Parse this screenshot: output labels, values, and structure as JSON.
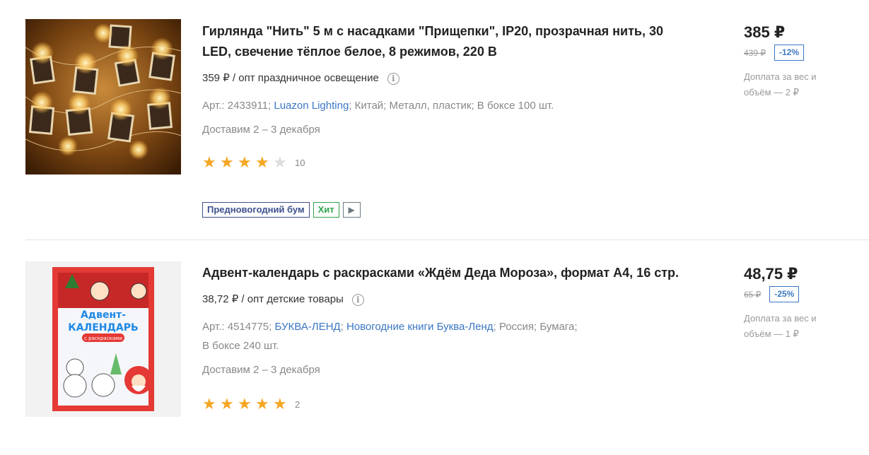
{
  "products": [
    {
      "title": "Гирлянда \"Нить\" 5 м с насадками \"Прищепки\", IP20, прозрачная нить, 30 LED, свечение тёплое белое, 8 режимов, 220 В",
      "opt_price": "359 ₽ / опт праздничное освещение",
      "meta": {
        "article": "Арт.: 2433911;",
        "brand": "Luazon Lighting",
        "country": "Китай;",
        "material": "Металл, пластик;",
        "box": "В боксе 100 шт."
      },
      "delivery": "Доставим 2 – 3 декабря",
      "rating": 4,
      "rating_count": "10",
      "badges": [
        "Предновогодний бум",
        "Хит"
      ],
      "price": "385 ₽",
      "old_price": "439 ₽",
      "discount": "-12%",
      "surcharge": "Доплата за вес и объём — 2 ₽"
    },
    {
      "title": "Адвент-календарь с раскрасками «Ждём Деда Мороза», формат А4, 16 стр.",
      "opt_price": "38,72 ₽ / опт детские товары",
      "meta": {
        "article": "Арт.: 4514775;",
        "brand": "БУКВА-ЛЕНД",
        "series": "Новогодние книги Буква-Ленд",
        "country": "Россия;",
        "material": "Бумага;",
        "box": "В боксе 240 шт."
      },
      "delivery": "Доставим 2 – 3 декабря",
      "rating": 5,
      "rating_count": "2",
      "price": "48,75 ₽",
      "old_price": "65 ₽",
      "discount": "-25%",
      "surcharge": "Доплата за вес и объём — 1 ₽"
    }
  ],
  "image_text": {
    "calendar_title_1": "Адвент-",
    "calendar_title_2": "КАЛЕНДАРЬ",
    "calendar_sub": "с раскрасками"
  },
  "icons": {
    "info": "info-icon",
    "star": "star-icon",
    "play": "play-icon"
  },
  "colors": {
    "link": "#3b77c4",
    "star": "#f5a623",
    "badge_blue": "#3d4f8c",
    "badge_green": "#2ea64a"
  }
}
